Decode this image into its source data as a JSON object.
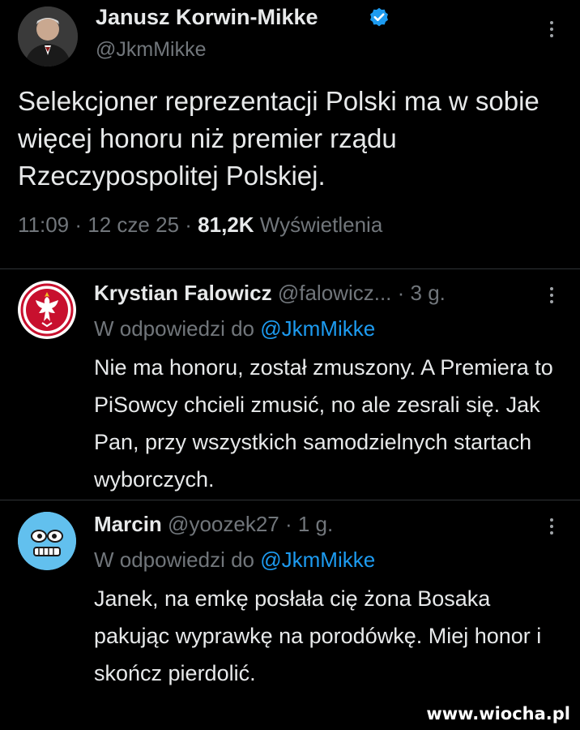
{
  "main_tweet": {
    "author_name": "Janusz Korwin-Mikke",
    "author_handle": "@JkmMikke",
    "text": "Selekcjoner reprezentacji Polski ma w sobie więcej honoru niż premier rządu Rzeczypospolitej Polskiej.",
    "time": "11:09",
    "separator": "·",
    "date": "12 cze 25",
    "views_count": "81,2K",
    "views_label": "Wyświetlenia",
    "verified_icon": "verified-badge-icon"
  },
  "replies": [
    {
      "author_name": "Krystian Falowicz",
      "author_handle": "@falowicz...",
      "age": "· 3 g.",
      "reply_to_label": "W odpowiedzi do",
      "reply_to_handle": "@JkmMikke",
      "text": "Nie ma honoru, został zmuszony. A Premiera to PiSowcy chcieli zmusić, no ale zesrali się. Jak Pan, przy wszystkich samodzielnych startach wyborczych.",
      "avatar_icon": "white-eagle-crest-icon"
    },
    {
      "author_name": "Marcin",
      "author_handle": "@yoozek27",
      "age": "· 1 g.",
      "reply_to_label": "W odpowiedzi do",
      "reply_to_handle": "@JkmMikke",
      "text": "Janek, na emkę posłała cię żona Bosaka pakując wyprawkę na porodówkę. Miej honor i skończ pierdolić.",
      "avatar_icon": "blue-robot-face-icon"
    }
  ],
  "watermark": "www.wiocha.pl",
  "colors": {
    "background": "#000000",
    "text_primary": "#e7e9ea",
    "text_secondary": "#71767b",
    "accent": "#1d9bf0",
    "divider": "#2f3336"
  }
}
